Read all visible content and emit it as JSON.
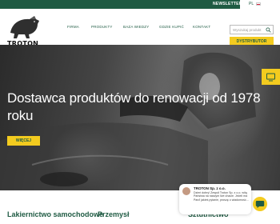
{
  "topbar": {
    "newsletter": "NEWSLETTER",
    "lang_code": "PL"
  },
  "header": {
    "logo_text": "TROTON",
    "nav": [
      "FIRMA",
      "PRODUKTY",
      "BAZA WIEDZY",
      "GDZIE KUPIĆ",
      "KONTAKT"
    ],
    "search_placeholder": "Wyszukaj produkt",
    "distributor_label": "DYSTRYBUTOR"
  },
  "hero": {
    "title": "Dostawca produktów do renowacji od 1978 roku",
    "more_label": "WIĘCEJ"
  },
  "categories": [
    "Lakiernictwo samochodowe",
    "Przemysł",
    "Sztutnictwo"
  ],
  "chat": {
    "company": "TROTON Sp. z o.o.",
    "message": "Dzień dobry! Zespół Troton Sp. z o.o. witą Państwa na naszym live chacie. Jeżeli ma Pan/i jakieś pytanie, proszę o wiadomość..."
  },
  "colors": {
    "brand_green": "#1f5b43",
    "accent_yellow": "#f3cb1f"
  }
}
